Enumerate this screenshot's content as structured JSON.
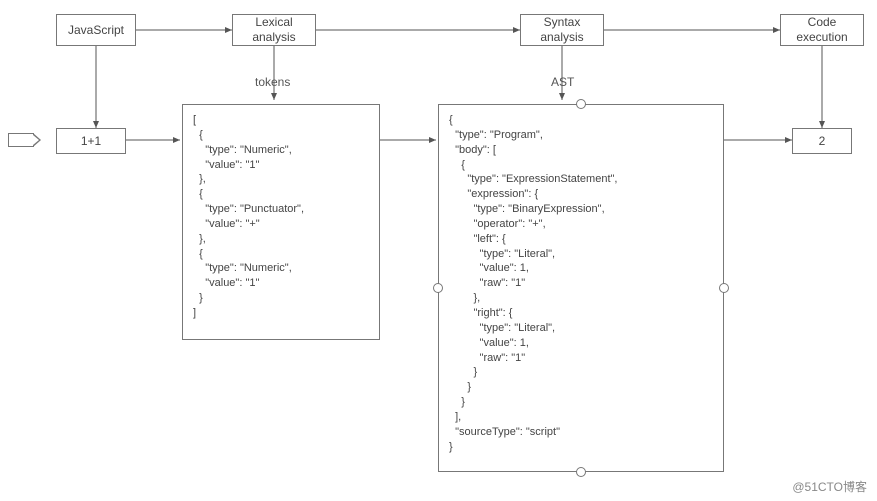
{
  "nodes": {
    "javascript": "JavaScript",
    "lexical": "Lexical\nanalysis",
    "syntax": "Syntax\nanalysis",
    "execution": "Code\nexecution",
    "input": "1+1",
    "output": "2"
  },
  "labels": {
    "tokens": "tokens",
    "ast": "AST"
  },
  "tokens_code": "[\n  {\n    \"type\": \"Numeric\",\n    \"value\": \"1\"\n  },\n  {\n    \"type\": \"Punctuator\",\n    \"value\": \"+\"\n  },\n  {\n    \"type\": \"Numeric\",\n    \"value\": \"1\"\n  }\n]",
  "ast_code": "{\n  \"type\": \"Program\",\n  \"body\": [\n    {\n      \"type\": \"ExpressionStatement\",\n      \"expression\": {\n        \"type\": \"BinaryExpression\",\n        \"operator\": \"+\",\n        \"left\": {\n          \"type\": \"Literal\",\n          \"value\": 1,\n          \"raw\": \"1\"\n        },\n        \"right\": {\n          \"type\": \"Literal\",\n          \"value\": 1,\n          \"raw\": \"1\"\n        }\n      }\n    }\n  ],\n  \"sourceType\": \"script\"\n}",
  "watermark": "@51CTO博客",
  "chart_data": {
    "type": "flow-diagram",
    "title": "JavaScript parsing/evaluation pipeline",
    "stages": [
      {
        "id": "javascript",
        "label": "JavaScript"
      },
      {
        "id": "lexical",
        "label": "Lexical analysis",
        "output_label": "tokens"
      },
      {
        "id": "syntax",
        "label": "Syntax analysis",
        "output_label": "AST"
      },
      {
        "id": "execution",
        "label": "Code execution"
      }
    ],
    "example": {
      "input": "1+1",
      "tokens": [
        {
          "type": "Numeric",
          "value": "1"
        },
        {
          "type": "Punctuator",
          "value": "+"
        },
        {
          "type": "Numeric",
          "value": "1"
        }
      ],
      "ast": {
        "type": "Program",
        "body": [
          {
            "type": "ExpressionStatement",
            "expression": {
              "type": "BinaryExpression",
              "operator": "+",
              "left": {
                "type": "Literal",
                "value": 1,
                "raw": "1"
              },
              "right": {
                "type": "Literal",
                "value": 1,
                "raw": "1"
              }
            }
          }
        ],
        "sourceType": "script"
      },
      "output": 2
    },
    "edges": [
      [
        "javascript",
        "lexical"
      ],
      [
        "lexical",
        "syntax"
      ],
      [
        "syntax",
        "execution"
      ],
      [
        "javascript",
        "input"
      ],
      [
        "lexical",
        "tokens_block"
      ],
      [
        "syntax",
        "ast_block"
      ],
      [
        "execution",
        "output"
      ],
      [
        "input",
        "tokens_block"
      ],
      [
        "tokens_block",
        "ast_block"
      ],
      [
        "ast_block",
        "output"
      ]
    ]
  }
}
